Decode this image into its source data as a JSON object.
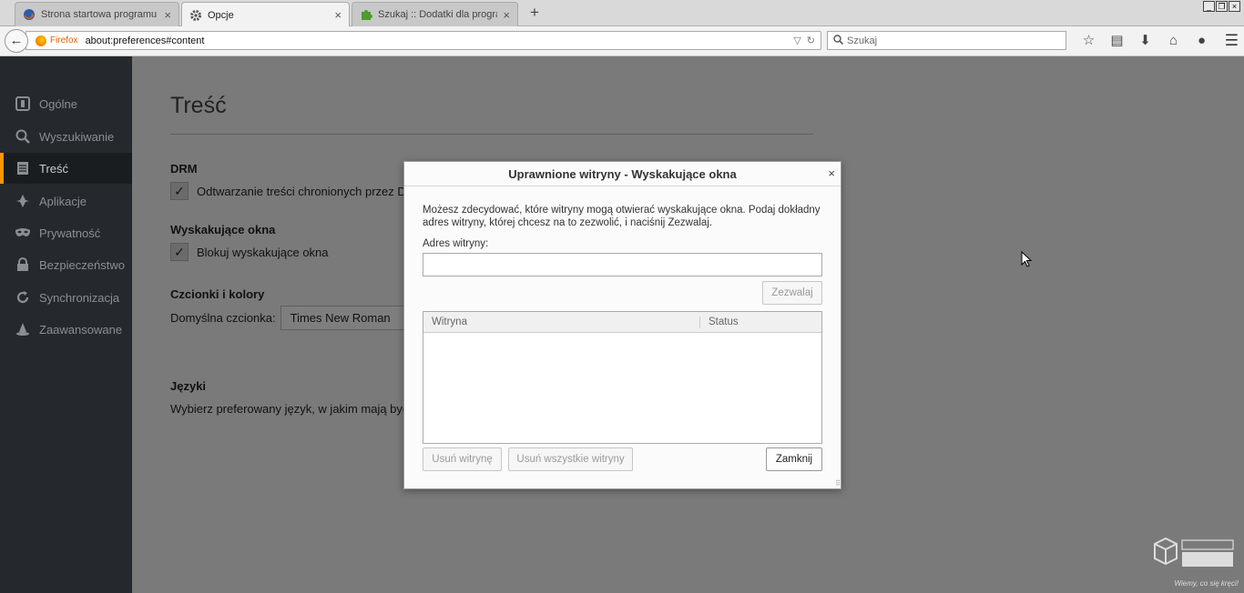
{
  "tabs": [
    {
      "title": "Strona startowa programu M...",
      "icon": "firefox-icon",
      "active": false
    },
    {
      "title": "Opcje",
      "icon": "gear-icon",
      "active": true
    },
    {
      "title": "Szukaj :: Dodatki dla program...",
      "icon": "puzzle-piece-icon",
      "active": false
    }
  ],
  "navbar": {
    "identity_label": "Firefox",
    "url": "about:preferences#content",
    "search_placeholder": "Szukaj"
  },
  "sidebar": {
    "items": [
      {
        "label": "Ogólne",
        "icon": "general-icon"
      },
      {
        "label": "Wyszukiwanie",
        "icon": "search-icon"
      },
      {
        "label": "Treść",
        "icon": "content-icon",
        "active": true
      },
      {
        "label": "Aplikacje",
        "icon": "applications-icon"
      },
      {
        "label": "Prywatność",
        "icon": "mask-icon"
      },
      {
        "label": "Bezpieczeństwo",
        "icon": "padlock-icon"
      },
      {
        "label": "Synchronizacja",
        "icon": "sync-icon"
      },
      {
        "label": "Zaawansowane",
        "icon": "hat-icon"
      }
    ]
  },
  "content": {
    "title": "Treść",
    "drm": {
      "heading": "DRM",
      "checkbox_label": "Odtwarzanie treści chronionych przez DRM",
      "checked": true
    },
    "popups": {
      "heading": "Wyskakujące okna",
      "checkbox_label": "Blokuj wyskakujące okna",
      "checked": true
    },
    "fonts": {
      "heading": "Czcionki i kolory",
      "default_font_label": "Domyślna czcionka:",
      "default_font_value": "Times New Roman"
    },
    "languages": {
      "heading": "Języki",
      "description": "Wybierz preferowany język, w jakim mają być w"
    }
  },
  "dialog": {
    "title": "Uprawnione witryny - Wyskakujące okna",
    "description": "Możesz zdecydować, które witryny mogą otwierać wyskakujące okna. Podaj dokładny adres witryny, której chcesz na to zezwolić, i naciśnij Zezwalaj.",
    "address_label": "Adres witryny:",
    "address_value": "",
    "allow_button": "Zezwalaj",
    "table_columns": [
      "Witryna",
      "Status"
    ],
    "table_rows": [],
    "remove_site_button": "Usuń witrynę",
    "remove_all_button": "Usuń wszystkie witryny",
    "close_button": "Zamknij"
  },
  "watermark": {
    "text": "Wiemy, co się kręci!"
  },
  "colors": {
    "sidebar_bg": "#25292e",
    "active_accent": "#ff9500",
    "firefox_orange": "#e66000"
  }
}
